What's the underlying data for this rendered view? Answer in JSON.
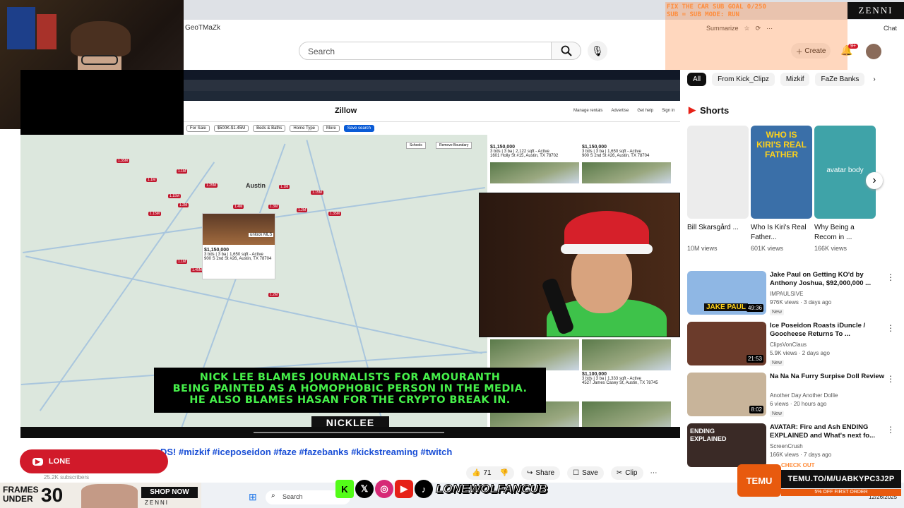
{
  "browser": {
    "channel_text": "GeoTMaZk",
    "summarize": "Summarize",
    "chat": "Chat"
  },
  "youtube": {
    "search_placeholder": "Search",
    "create_label": "Create",
    "notif_count": "9+"
  },
  "overlay_top": {
    "line1": "FIX THE CAR SUB GOAL 0/250",
    "line2": "SUB = SUB MODE: RUN",
    "line3": "",
    "zenni": "ZENNI"
  },
  "zillow": {
    "logo": "Zillow",
    "links": [
      "Manage rentals",
      "Advertise",
      "Get help",
      "Sign in"
    ],
    "filters": [
      "For Sale",
      "$500K-$1.45M",
      "Beds & Baths",
      "Home Type",
      "More",
      "Save search"
    ],
    "map_city": "Austin",
    "schools": "Schools",
    "remove_boundary": "Remove Boundary",
    "map_card": {
      "price": "$1,150,000",
      "details": "3 bds | 3 ba | 1,650 sqft - Active",
      "address": "900 S 2nd St #26, Austin, TX 78704",
      "badge": "unlock MLS"
    },
    "listings": [
      {
        "price": "$1,150,000",
        "details": "3 bds | 3 ba | 2,122 sqft - Active",
        "address": "1601 Holly St #15, Austin, TX 78702"
      },
      {
        "price": "$1,150,000",
        "details": "3 bds | 3 ba | 1,650 sqft - Active",
        "address": "900 S 2nd St #26, Austin, TX 78704"
      },
      {
        "price": "$1,100,000",
        "details": "3 bds | 3 ba | 1,333 sqft - Active",
        "address": "4527 James Casey St, Austin, TX 78745"
      }
    ],
    "pins": [
      "1.35M",
      "1.1M",
      "1.15M",
      "1.2M",
      "1.15M",
      "1.1M",
      "1.25M",
      "1.4M",
      "1.3M",
      "1.1M",
      "1.2M",
      "1.15M",
      "1.35M",
      "1.1M",
      "1.45M",
      "1.2M"
    ]
  },
  "video": {
    "caption_line1": "NICK LEE BLAMES JOURNALISTS FOR AMOURANTH",
    "caption_line2": "BEING PAINTED AS A HOMOPHOBIC PERSON IN THE MEDIA.",
    "caption_line3": "HE ALSO BLAMES HASAN FOR THE CRYPTO BREAK IN.",
    "nicklee_tag": "NICKLEE",
    "title": "DS! #mizkif #iceposeidon #faze #fazebanks #kickstreaming #twitch",
    "subscribers": "25.2K subscribers",
    "likes": "71",
    "share": "Share",
    "save": "Save",
    "clip": "Clip",
    "lone_label": "LONE"
  },
  "sidebar": {
    "chips": [
      "All",
      "From Kick_Clipz",
      "Mizkif",
      "FaZe Banks"
    ],
    "shorts_label": "Shorts",
    "shorts": [
      {
        "title": "Bill Skarsgård ...",
        "views": "10M views",
        "overlay": "",
        "color": "#e9e9e9"
      },
      {
        "title": "Who Is Kiri's Real Father...",
        "views": "601K views",
        "overlay": "WHO IS KIRI'S REAL FATHER",
        "color": "#3a6fa8"
      },
      {
        "title": "Why Being a Recom in ...",
        "views": "166K views",
        "overlay": "avatar body",
        "color": "#3fa3a8"
      }
    ],
    "videos": [
      {
        "title": "Jake Paul on Getting KO'd by Anthony Joshua, $92,000,000 ...",
        "channel": "IMPAULSIVE",
        "meta": "976K views · 3 days ago",
        "badge": "New",
        "duration": "49:36",
        "thumb_text": "JAKE PAUL",
        "color": "#8fb7e4"
      },
      {
        "title": "Ice Poseidon Roasts iDuncle / Goocheese Returns To ...",
        "channel": "ClipsVonClaus",
        "meta": "5.9K views · 2 days ago",
        "badge": "New",
        "duration": "21:53",
        "thumb_text": "",
        "color": "#6b3b2b"
      },
      {
        "title": "Na Na Na Furry Surpise Doll Review",
        "channel": "Another Day Another Dollie",
        "meta": "6 views · 20 hours ago",
        "badge": "New",
        "duration": "8:02",
        "thumb_text": "",
        "color": "#c8b49a"
      },
      {
        "title": "AVATAR: Fire and Ash ENDING EXPLAINED and What's next fo...",
        "channel": "ScreenCrush",
        "meta": "166K views · 7 days ago",
        "badge": "",
        "duration": "",
        "thumb_text": "ENDING EXPLAINED",
        "color": "#3a2a26"
      }
    ]
  },
  "bottom": {
    "frames_text": "FRAMES UNDER",
    "frames_num": "30",
    "shop_now": "SHOP NOW",
    "zenni": "ZENNI",
    "handle": "LONEWOLFANCUB",
    "taskbar_search": "Search",
    "temu_check": "CHECK OUT",
    "temu_name": "TEMU",
    "temu_code": "TEMU.TO/M/UABKYPC3J2P",
    "temu_off": "5% OFF FIRST ORDER",
    "date": "12/26/2025"
  },
  "colors": {
    "accent": "#d11a2a",
    "caption": "#46f04a",
    "link": "#1a4fd6"
  }
}
